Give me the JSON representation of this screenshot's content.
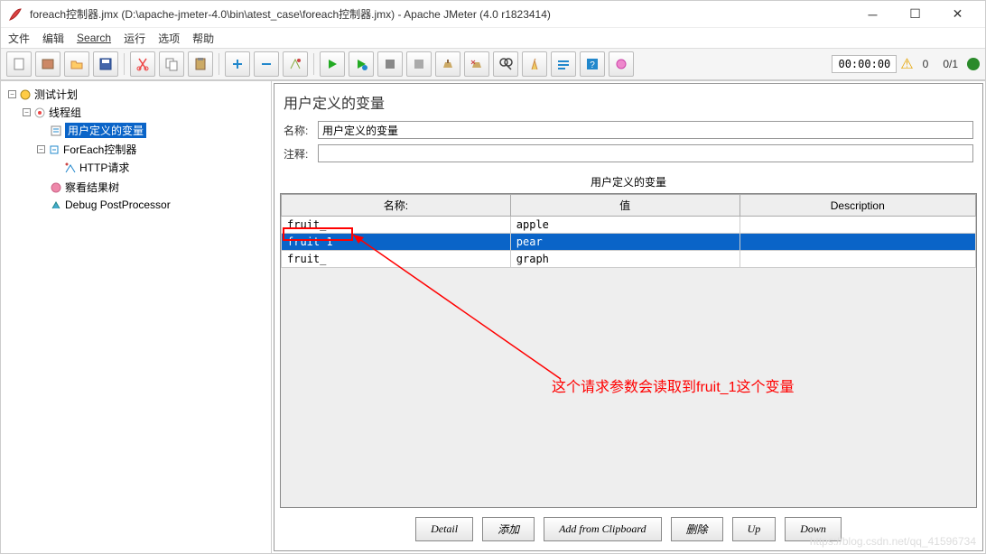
{
  "window": {
    "title": "foreach控制器.jmx (D:\\apache-jmeter-4.0\\bin\\atest_case\\foreach控制器.jmx) - Apache JMeter (4.0 r1823414)"
  },
  "menubar": {
    "file": "文件",
    "edit": "编辑",
    "search": "Search",
    "run": "运行",
    "options": "选项",
    "help": "帮助"
  },
  "toolbar": {
    "timer": "00:00:00",
    "count": "0",
    "total": "0/1"
  },
  "tree": {
    "root": "测试计划",
    "threadGroup": "线程组",
    "userVars": "用户定义的变量",
    "foreach": "ForEach控制器",
    "http": "HTTP请求",
    "results": "察看结果树",
    "debug": "Debug PostProcessor"
  },
  "panel": {
    "title": "用户定义的变量",
    "nameLabel": "名称:",
    "nameValue": "用户定义的变量",
    "commentLabel": "注释:",
    "commentValue": "",
    "sectionLabel": "用户定义的变量",
    "headers": {
      "name": "名称:",
      "value": "值",
      "desc": "Description"
    },
    "rows": [
      {
        "name": "fruit_",
        "value": "apple",
        "desc": ""
      },
      {
        "name": "fruit 1",
        "value": "pear",
        "desc": ""
      },
      {
        "name": "fruit_",
        "value": "graph",
        "desc": ""
      }
    ],
    "buttons": {
      "detail": "Detail",
      "add": "添加",
      "clipboard": "Add from Clipboard",
      "delete": "删除",
      "up": "Up",
      "down": "Down"
    }
  },
  "annotation": {
    "text": "这个请求参数会读取到fruit_1这个变量"
  },
  "watermark": "https://blog.csdn.net/qq_41596734"
}
